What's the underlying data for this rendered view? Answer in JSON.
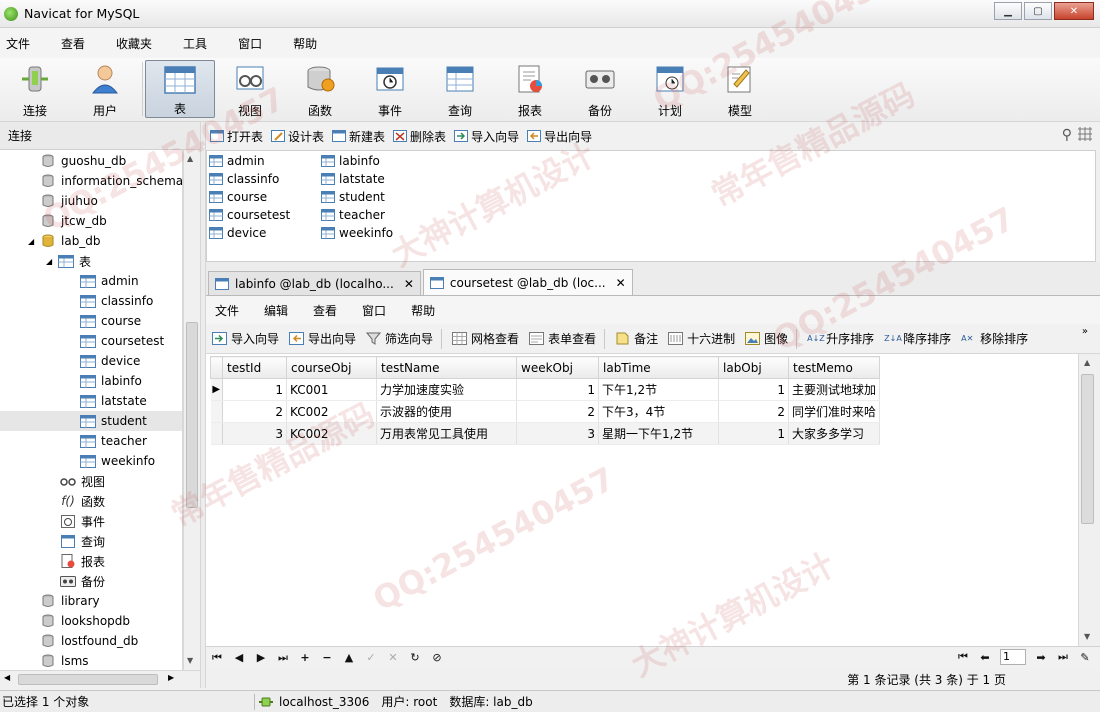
{
  "window": {
    "title": "Navicat for MySQL"
  },
  "menubar": {
    "items": [
      "文件",
      "查看",
      "收藏夹",
      "工具",
      "窗口",
      "帮助"
    ]
  },
  "toolbar": {
    "buttons": [
      {
        "label": "连接",
        "icon": "connection-icon"
      },
      {
        "label": "用户",
        "icon": "user-icon"
      },
      {
        "label": "表",
        "icon": "table-icon",
        "active": true
      },
      {
        "label": "视图",
        "icon": "view-icon"
      },
      {
        "label": "函数",
        "icon": "function-icon"
      },
      {
        "label": "事件",
        "icon": "event-icon"
      },
      {
        "label": "查询",
        "icon": "query-icon"
      },
      {
        "label": "报表",
        "icon": "report-icon"
      },
      {
        "label": "备份",
        "icon": "backup-icon"
      },
      {
        "label": "计划",
        "icon": "schedule-icon"
      },
      {
        "label": "模型",
        "icon": "model-icon"
      }
    ]
  },
  "connection_panel": {
    "header": "连接",
    "tree": [
      {
        "label": "guoshu_db",
        "type": "database"
      },
      {
        "label": "information_schema",
        "type": "database"
      },
      {
        "label": "jiuhuo",
        "type": "database"
      },
      {
        "label": "jtcw_db",
        "type": "database"
      },
      {
        "label": "lab_db",
        "type": "database",
        "expanded": true
      },
      {
        "label": "表",
        "type": "folder",
        "expanded": true
      },
      {
        "label": "admin",
        "type": "table"
      },
      {
        "label": "classinfo",
        "type": "table"
      },
      {
        "label": "course",
        "type": "table"
      },
      {
        "label": "coursetest",
        "type": "table"
      },
      {
        "label": "device",
        "type": "table"
      },
      {
        "label": "labinfo",
        "type": "table"
      },
      {
        "label": "latstate",
        "type": "table"
      },
      {
        "label": "student",
        "type": "table",
        "selected": true
      },
      {
        "label": "teacher",
        "type": "table"
      },
      {
        "label": "weekinfo",
        "type": "table"
      },
      {
        "label": "视图",
        "type": "view-folder"
      },
      {
        "label": "函数",
        "type": "function-folder"
      },
      {
        "label": "事件",
        "type": "event-folder"
      },
      {
        "label": "查询",
        "type": "query-folder"
      },
      {
        "label": "报表",
        "type": "report-folder"
      },
      {
        "label": "备份",
        "type": "backup-folder"
      },
      {
        "label": "library",
        "type": "database"
      },
      {
        "label": "lookshopdb",
        "type": "database"
      },
      {
        "label": "lostfound_db",
        "type": "database"
      },
      {
        "label": "lsms",
        "type": "database"
      }
    ]
  },
  "object_toolbar": {
    "buttons": [
      "打开表",
      "设计表",
      "新建表",
      "删除表",
      "导入向导",
      "导出向导"
    ]
  },
  "object_list": {
    "col1": [
      "admin",
      "classinfo",
      "course",
      "coursetest",
      "device"
    ],
    "col2": [
      "labinfo",
      "latstate",
      "student",
      "teacher",
      "weekinfo"
    ]
  },
  "tabs": [
    {
      "label": "labinfo @lab_db (localho...",
      "active": false
    },
    {
      "label": "coursetest @lab_db (loc...",
      "active": true
    }
  ],
  "inner_menu": [
    "文件",
    "编辑",
    "查看",
    "窗口",
    "帮助"
  ],
  "data_toolbar": {
    "buttons": [
      "导入向导",
      "导出向导",
      "筛选向导",
      "网格查看",
      "表单查看",
      "备注",
      "十六进制",
      "图像",
      "升序排序",
      "降序排序",
      "移除排序"
    ]
  },
  "grid": {
    "columns": [
      "testId",
      "courseObj",
      "testName",
      "weekObj",
      "labTime",
      "labObj",
      "testMemo"
    ],
    "rows": [
      [
        "1",
        "KC001",
        "力学加速度实验",
        "1",
        "下午1,2节",
        "1",
        "主要测试地球加"
      ],
      [
        "2",
        "KC002",
        "示波器的使用",
        "2",
        "下午3，4节",
        "2",
        "同学们准时来哈"
      ],
      [
        "3",
        "KC002",
        "万用表常见工具使用",
        "3",
        "星期一下午1,2节",
        "1",
        "大家多多学习"
      ]
    ]
  },
  "navigation": {
    "page_value": "1"
  },
  "record_info": "第 1 条记录 (共 3 条) 于 1 页",
  "statusbar": {
    "selection": "已选择 1 个对象",
    "server": "localhost_3306",
    "user": "用户: root",
    "database": "数据库: lab_db"
  },
  "watermark": {
    "lines": [
      "QQ:254540457",
      "大神计算机设计",
      "常年售精品源码"
    ]
  },
  "colors": {
    "accent": "#c9d3de",
    "table_icon": "#4a7fb5",
    "db_icon": "#9aa3ad",
    "lab_db_icon": "#e0b43a"
  }
}
